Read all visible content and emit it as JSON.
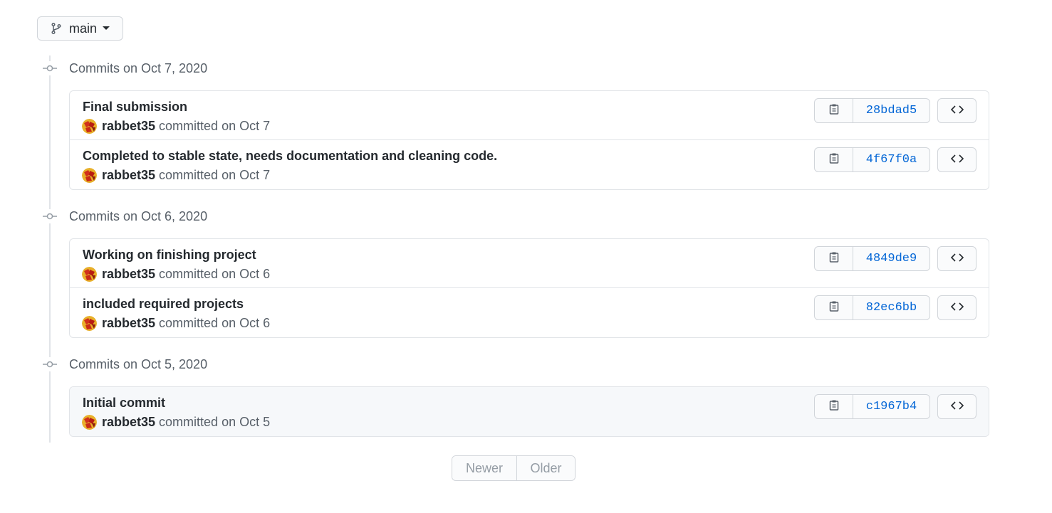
{
  "branch": {
    "name": "main",
    "icon": "git-branch-icon"
  },
  "days": [
    {
      "title": "Commits on Oct 7, 2020",
      "commits": [
        {
          "message": "Final submission",
          "author": "rabbet35",
          "committed": "committed on Oct 7",
          "sha": "28bdad5"
        },
        {
          "message": "Completed to stable state, needs documentation and cleaning code.",
          "author": "rabbet35",
          "committed": "committed on Oct 7",
          "sha": "4f67f0a"
        }
      ]
    },
    {
      "title": "Commits on Oct 6, 2020",
      "commits": [
        {
          "message": "Working on finishing project",
          "author": "rabbet35",
          "committed": "committed on Oct 6",
          "sha": "4849de9"
        },
        {
          "message": "included required projects",
          "author": "rabbet35",
          "committed": "committed on Oct 6",
          "sha": "82ec6bb"
        }
      ]
    },
    {
      "title": "Commits on Oct 5, 2020",
      "commits": [
        {
          "message": "Initial commit",
          "author": "rabbet35",
          "committed": "committed on Oct 5",
          "sha": "c1967b4"
        }
      ]
    }
  ],
  "pagination": {
    "newer": "Newer",
    "older": "Older"
  },
  "colors": {
    "link": "#0366d6",
    "muted": "#586069",
    "border": "#e1e4e8",
    "disabled": "#959da5"
  }
}
